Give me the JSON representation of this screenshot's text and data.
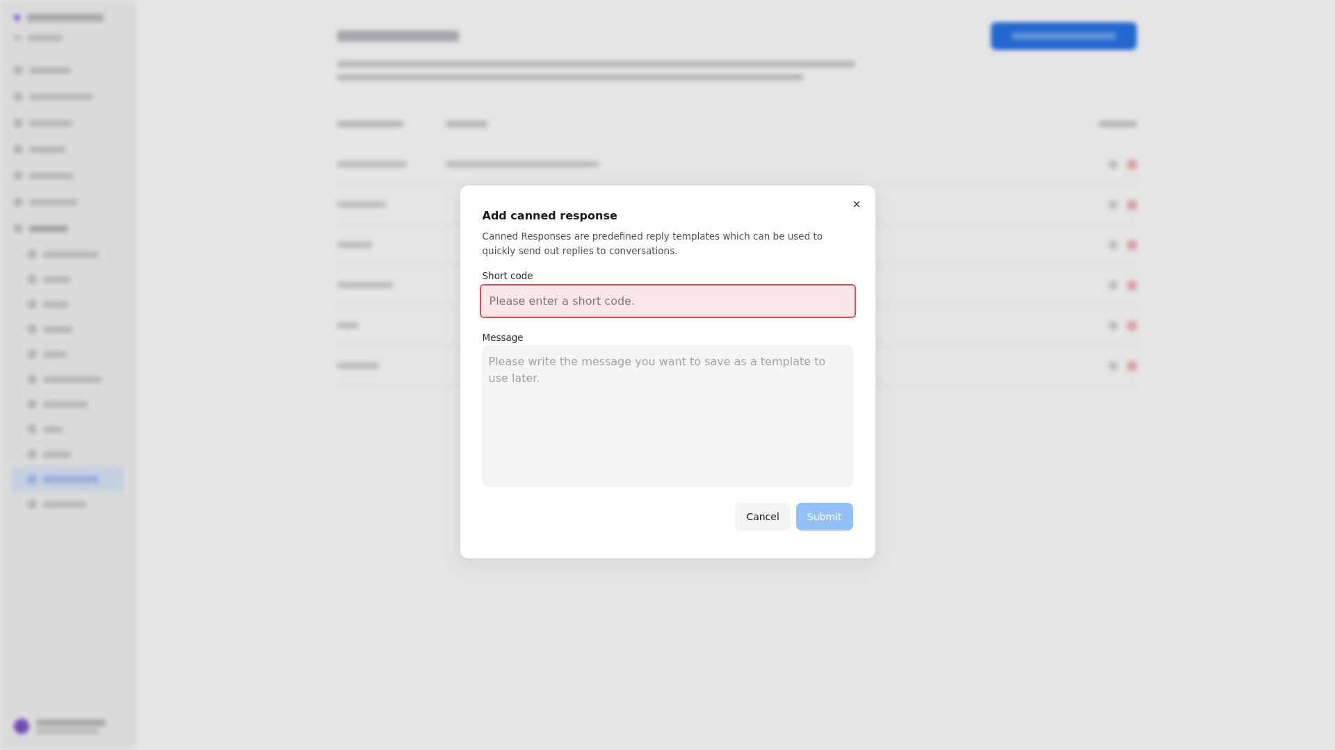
{
  "dialog": {
    "title": "Add canned response",
    "description": "Canned Responses are predefined reply templates which can be used to quickly send out replies to conversations.",
    "fields": [
      {
        "kind": "input",
        "label": "Short code",
        "placeholder": "Please enter a short code.",
        "error": true
      },
      {
        "kind": "textarea",
        "label": "Message",
        "placeholder": "Please write the message you want to save as a template to use later.",
        "error": false
      }
    ],
    "buttons": [
      {
        "kind": "secondary",
        "label": "Cancel",
        "disabled": false
      },
      {
        "kind": "primary",
        "label": "Submit",
        "disabled": true
      }
    ]
  }
}
